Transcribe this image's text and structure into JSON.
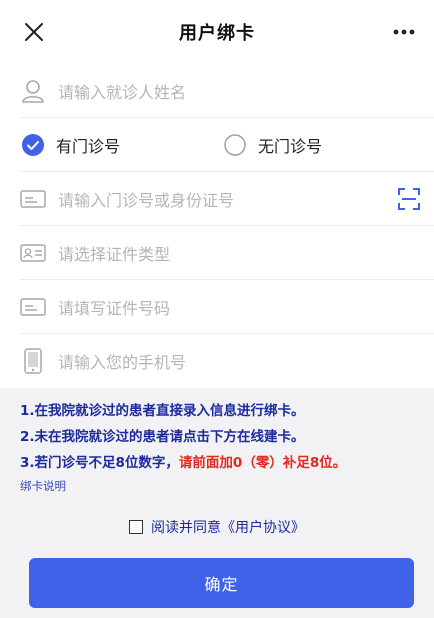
{
  "header": {
    "title": "用户绑卡"
  },
  "form": {
    "name_placeholder": "请输入就诊人姓名",
    "radio_has_card": "有门诊号",
    "radio_no_card": "无门诊号",
    "selected": "有门诊号",
    "card_placeholder": "请输入门诊号或身份证号",
    "id_type_placeholder": "请选择证件类型",
    "id_number_placeholder": "请填写证件号码",
    "phone_placeholder": "请输入您的手机号"
  },
  "notice": {
    "line1": "1.在我院就诊过的患者直接录入信息进行绑卡。",
    "line2": "2.未在我院就诊过的患者请点击下方在线建卡。",
    "line3_prefix": "3.若门诊号不足8位数字，",
    "line3_red": "请前面加0（零）补足8位。",
    "help_link": "绑卡说明"
  },
  "agreement": {
    "label": "阅读并同意《用户协议》",
    "checked": false
  },
  "button": {
    "confirm": "确定"
  },
  "colors": {
    "accent": "#3f62e8",
    "notice_text": "#1c2a9c",
    "warning": "#e2291f"
  }
}
